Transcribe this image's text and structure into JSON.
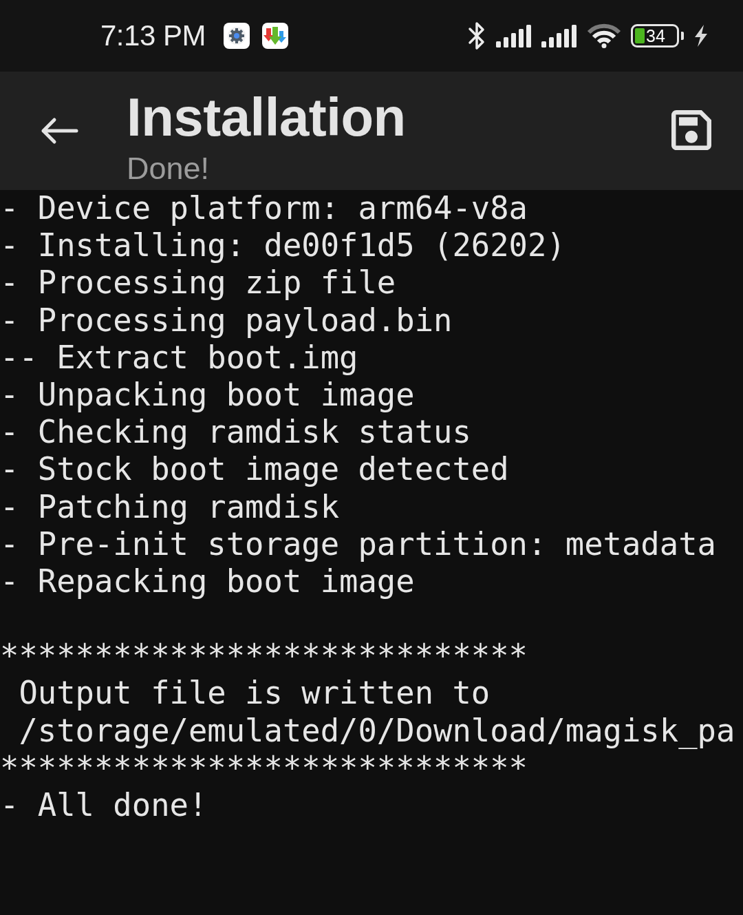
{
  "status_bar": {
    "time": "7:13 PM",
    "battery_text": "34"
  },
  "app_bar": {
    "title": "Installation",
    "subtitle": "Done!"
  },
  "log": {
    "sections": [
      {
        "lines": [
          "- Device platform: arm64-v8a",
          "- Installing: de00f1d5 (26202)",
          "- Processing zip file",
          "- Processing payload.bin",
          "-- Extract boot.img",
          "- Unpacking boot image",
          "- Checking ramdisk status",
          "- Stock boot image detected",
          "- Patching ramdisk",
          "- Pre-init storage partition: metadata",
          "- Repacking boot image"
        ]
      },
      {
        "lines": [
          "****************************",
          " Output file is written to",
          " /storage/emulated/0/Download/magisk_pa",
          "****************************",
          "- All done!"
        ]
      }
    ]
  }
}
